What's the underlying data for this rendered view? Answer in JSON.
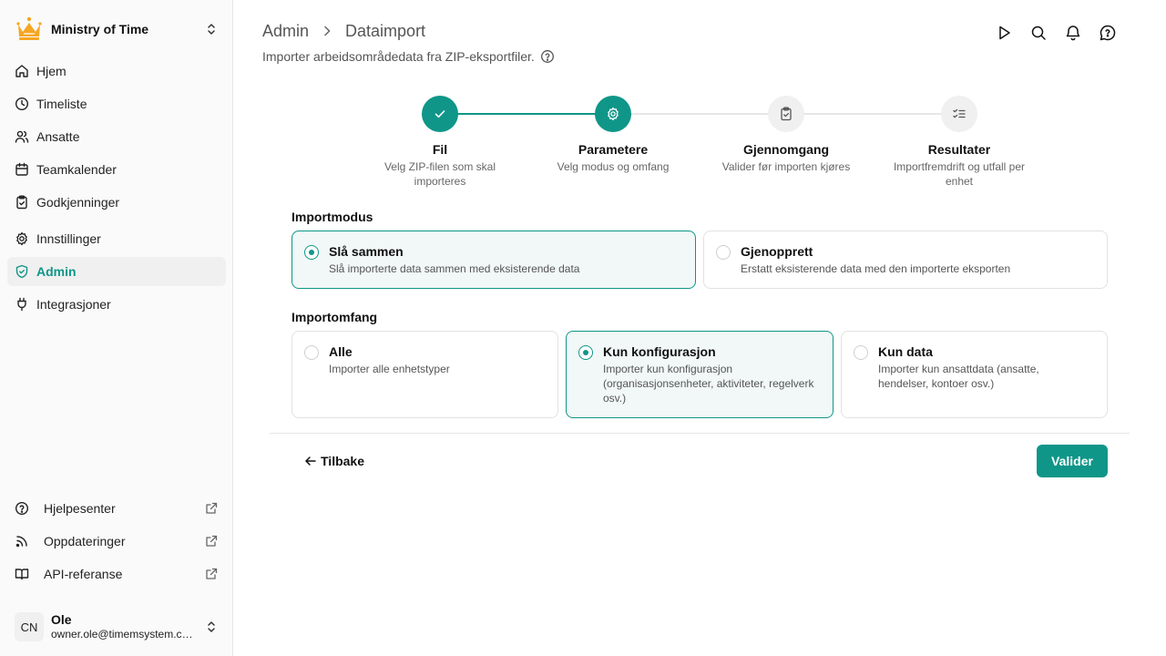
{
  "org": {
    "name": "Ministry of Time",
    "logo_icon": "crown-icon"
  },
  "nav": [
    {
      "label": "Hjem",
      "icon": "home-icon"
    },
    {
      "label": "Timeliste",
      "icon": "clock-icon"
    },
    {
      "label": "Ansatte",
      "icon": "users-icon"
    },
    {
      "label": "Teamkalender",
      "icon": "calendar-icon"
    },
    {
      "label": "Godkjenninger",
      "icon": "clipboard-check-icon"
    },
    {
      "label": "Innstillinger",
      "icon": "gear-icon"
    },
    {
      "label": "Admin",
      "icon": "shield-check-icon",
      "active": true
    },
    {
      "label": "Integrasjoner",
      "icon": "plug-icon"
    }
  ],
  "footer_nav": [
    {
      "label": "Hjelpesenter",
      "icon": "help-circle-icon"
    },
    {
      "label": "Oppdateringer",
      "icon": "rss-icon"
    },
    {
      "label": "API-referanse",
      "icon": "book-icon"
    }
  ],
  "user": {
    "initials": "CN",
    "name": "Ole",
    "email": "owner.ole@timemsystem.com"
  },
  "header": {
    "breadcrumb": [
      "Admin",
      "Dataimport"
    ],
    "subtitle": "Importer arbeidsområdedata fra ZIP-eksportfiler."
  },
  "steps": [
    {
      "title": "Fil",
      "desc": "Velg ZIP-filen som skal importeres",
      "state": "done"
    },
    {
      "title": "Parametere",
      "desc": "Velg modus og omfang",
      "state": "current"
    },
    {
      "title": "Gjennomgang",
      "desc": "Valider før importen kjøres",
      "state": "pending"
    },
    {
      "title": "Resultater",
      "desc": "Importfremdrift og utfall per enhet",
      "state": "pending"
    }
  ],
  "import_mode": {
    "label": "Importmodus",
    "options": [
      {
        "title": "Slå sammen",
        "desc": "Slå importerte data sammen med eksisterende data",
        "selected": true
      },
      {
        "title": "Gjenopprett",
        "desc": "Erstatt eksisterende data med den importerte eksporten",
        "selected": false
      }
    ]
  },
  "import_scope": {
    "label": "Importomfang",
    "options": [
      {
        "title": "Alle",
        "desc": "Importer alle enhetstyper",
        "selected": false
      },
      {
        "title": "Kun konfigurasjon",
        "desc": "Importer kun konfigurasjon (organisasjonsenheter, aktiviteter, regelverk osv.)",
        "selected": true
      },
      {
        "title": "Kun data",
        "desc": "Importer kun ansattdata (ansatte, hendelser, kontoer osv.)",
        "selected": false
      }
    ]
  },
  "actions": {
    "back": "Tilbake",
    "validate": "Valider"
  },
  "colors": {
    "accent": "#0f9688",
    "logo": "#f5a623"
  }
}
